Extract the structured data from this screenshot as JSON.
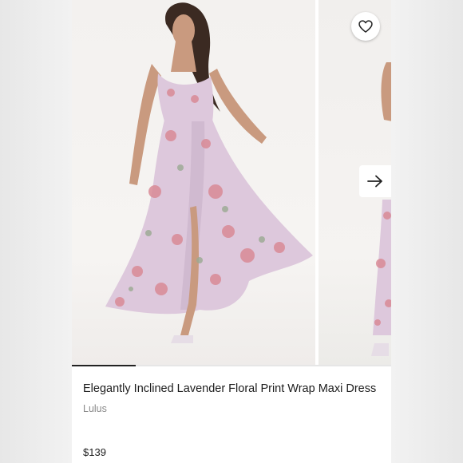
{
  "listing": {
    "title": "Elegantly Inclined Lavender Floral Print Wrap Maxi Dress",
    "brand": "Lulus",
    "price": "$139"
  },
  "carousel": {
    "active_index": 0,
    "slide_count": 2
  },
  "icons": {
    "favorite": "heart-outline-icon",
    "next": "arrow-right-icon"
  },
  "colors": {
    "dress": "#ddc8dc",
    "floral": "#d98a96",
    "indicator_active": "#222222",
    "text": "#1c1c1c",
    "brand_text": "#8a8a8a"
  }
}
